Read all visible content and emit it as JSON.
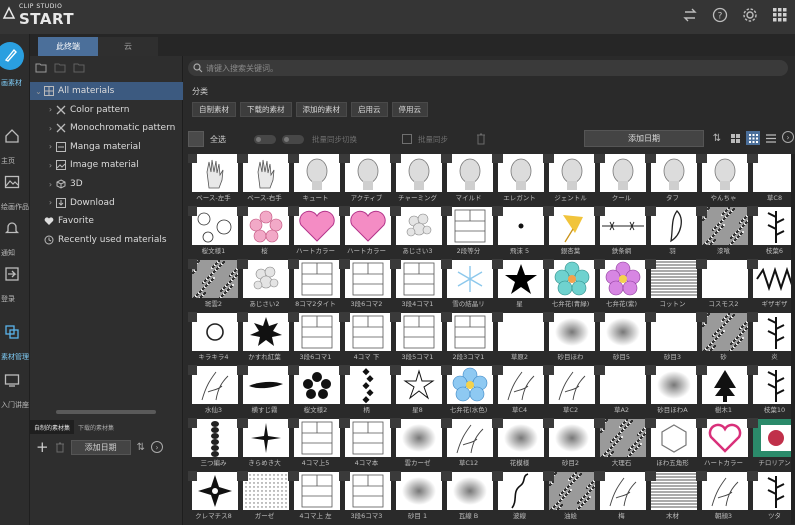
{
  "app": {
    "logo_small": "CLIP STUDIO",
    "logo_big": "START"
  },
  "colors": {
    "accent": "#2a9fe0",
    "selected": "#3c5a80",
    "tab_active": "#4b6f9a"
  },
  "titlebar_icons": [
    "sync-icon",
    "help-icon",
    "settings-icon",
    "apps-grid-icon"
  ],
  "nav": [
    {
      "label": "画素材",
      "icon": "brush-icon"
    },
    {
      "label": "主页",
      "icon": "home-icon"
    },
    {
      "label": "绘画作品",
      "icon": "artwork-icon"
    },
    {
      "label": "通知",
      "icon": "bell-icon"
    },
    {
      "label": "登录",
      "icon": "login-icon"
    },
    {
      "label": "素材管理",
      "icon": "materials-icon"
    },
    {
      "label": "入门讲座",
      "icon": "lecture-icon"
    }
  ],
  "tabs": [
    "此终端",
    "云"
  ],
  "tree": [
    {
      "label": "All materials",
      "icon": "grid-icon",
      "arrow": "⌄",
      "indent": 0,
      "selected": true
    },
    {
      "label": "Color pattern",
      "icon": "cross-icon",
      "arrow": "›",
      "indent": 1
    },
    {
      "label": "Monochromatic pattern",
      "icon": "cross-icon",
      "arrow": "›",
      "indent": 1
    },
    {
      "label": "Manga material",
      "icon": "frame-icon",
      "arrow": "›",
      "indent": 1
    },
    {
      "label": "Image material",
      "icon": "image-icon",
      "arrow": "›",
      "indent": 1
    },
    {
      "label": "3D",
      "icon": "3d-icon",
      "arrow": "›",
      "indent": 1
    },
    {
      "label": "Download",
      "icon": "download-icon",
      "arrow": "›",
      "indent": 1
    },
    {
      "label": "Favorite",
      "icon": "heart-icon",
      "arrow": "",
      "indent": 0
    },
    {
      "label": "Recently used materials",
      "icon": "history-icon",
      "arrow": "",
      "indent": 0
    }
  ],
  "tree_bottom": {
    "tab_a": "自制的素材集",
    "tab_b": "下载的素材集",
    "sort_label": "添加日期"
  },
  "search": {
    "placeholder": "请键入搜索关键词。"
  },
  "category": {
    "label": "分类",
    "tags": [
      "自制素材",
      "下载的素材",
      "添加的素材",
      "启用云",
      "停用云"
    ]
  },
  "toolbar": {
    "select_all": "全选",
    "batch_sync": "批量同步切换",
    "batch_sync2": "批量同步",
    "sort": "添加日期"
  },
  "grid": [
    [
      {
        "l": "ベース-左手",
        "k": "hand"
      },
      {
        "l": "ベース-右手",
        "k": "hand"
      },
      {
        "l": "キュート",
        "k": "head"
      },
      {
        "l": "アクティブ",
        "k": "head"
      },
      {
        "l": "チャーミング",
        "k": "head"
      },
      {
        "l": "マイルド",
        "k": "head"
      },
      {
        "l": "エレガント",
        "k": "head"
      },
      {
        "l": "ジェントル",
        "k": "head"
      },
      {
        "l": "クール",
        "k": "head"
      },
      {
        "l": "タフ",
        "k": "head"
      },
      {
        "l": "やんちゃ",
        "k": "head"
      },
      {
        "l": "草C8",
        "k": "blank"
      }
    ],
    [
      {
        "l": "桜文様1",
        "k": "pattern"
      },
      {
        "l": "桜",
        "k": "flower"
      },
      {
        "l": "ハートカラー",
        "k": "heart"
      },
      {
        "l": "ハートカラー",
        "k": "heart"
      },
      {
        "l": "あじさい3",
        "k": "hydra"
      },
      {
        "l": "2段等分",
        "k": "panels"
      },
      {
        "l": "飛沫 5",
        "k": "dot"
      },
      {
        "l": "銀杏葉",
        "k": "ginkgo"
      },
      {
        "l": "鉄条網",
        "k": "wire"
      },
      {
        "l": "羽",
        "k": "feather"
      },
      {
        "l": "漆喰",
        "k": "noise"
      },
      {
        "l": "枝葉6",
        "k": "leaf"
      }
    ],
    [
      {
        "l": "斑雲2",
        "k": "noise"
      },
      {
        "l": "あじさい2",
        "k": "hydra"
      },
      {
        "l": "8コマ2タイト",
        "k": "panels"
      },
      {
        "l": "3段6コマ2",
        "k": "panels"
      },
      {
        "l": "3段4コマ1",
        "k": "panels"
      },
      {
        "l": "雪の結晶リ",
        "k": "snow"
      },
      {
        "l": "星",
        "k": "star"
      },
      {
        "l": "七弁花(青緑)",
        "k": "cflower"
      },
      {
        "l": "七弁花(紫)",
        "k": "pflower"
      },
      {
        "l": "コットン",
        "k": "lines"
      },
      {
        "l": "コスモス2",
        "k": "blank"
      },
      {
        "l": "ギザギザ",
        "k": "zigzag"
      }
    ],
    [
      {
        "l": "キラキラ4",
        "k": "ring"
      },
      {
        "l": "かすれ紅葉",
        "k": "maple"
      },
      {
        "l": "3段6コマ1",
        "k": "panels"
      },
      {
        "l": "4コマ 下",
        "k": "panels"
      },
      {
        "l": "3段5コマ1",
        "k": "panels"
      },
      {
        "l": "2段3コマ1",
        "k": "panels"
      },
      {
        "l": "草原2",
        "k": "blank"
      },
      {
        "l": "砂目ほわ",
        "k": "blur"
      },
      {
        "l": "砂目5",
        "k": "blur"
      },
      {
        "l": "砂目3",
        "k": "blank"
      },
      {
        "l": "砂",
        "k": "noise"
      },
      {
        "l": "炎",
        "k": "leaf"
      }
    ],
    [
      {
        "l": "水仙3",
        "k": "sketch"
      },
      {
        "l": "横すじ霧",
        "k": "streak"
      },
      {
        "l": "桜文様2",
        "k": "flowerb"
      },
      {
        "l": "柄",
        "k": "diamond"
      },
      {
        "l": "星8",
        "k": "starline"
      },
      {
        "l": "七弁花(水色)",
        "k": "bflower"
      },
      {
        "l": "草C4",
        "k": "sketch"
      },
      {
        "l": "草C2",
        "k": "sketch"
      },
      {
        "l": "草A2",
        "k": "blank"
      },
      {
        "l": "砂目ほわA",
        "k": "blur"
      },
      {
        "l": "樹木1",
        "k": "tree"
      },
      {
        "l": "枝葉10",
        "k": "leaf"
      }
    ],
    [
      {
        "l": "三つ編み",
        "k": "braid"
      },
      {
        "l": "きらめき大",
        "k": "sparkle"
      },
      {
        "l": "4コマ上5",
        "k": "panels"
      },
      {
        "l": "4コマ本",
        "k": "panels"
      },
      {
        "l": "雲カーゼ",
        "k": "blur"
      },
      {
        "l": "草C12",
        "k": "sketch"
      },
      {
        "l": "花模様",
        "k": "blur"
      },
      {
        "l": "砂目2",
        "k": "blur"
      },
      {
        "l": "大理石",
        "k": "noise"
      },
      {
        "l": "ほわ五角形",
        "k": "hex"
      },
      {
        "l": "ハートカラー",
        "k": "heartline"
      },
      {
        "l": "チロリアン",
        "k": "tyrol"
      }
    ],
    [
      {
        "l": "クレマチス8",
        "k": "clem"
      },
      {
        "l": "ガーゼ",
        "k": "dots"
      },
      {
        "l": "4コマ上 左",
        "k": "panels"
      },
      {
        "l": "3段6コマ3",
        "k": "panels"
      },
      {
        "l": "砂目 1",
        "k": "blur"
      },
      {
        "l": "瓦線 B",
        "k": "blur"
      },
      {
        "l": "波線",
        "k": "wave"
      },
      {
        "l": "油絵",
        "k": "noise"
      },
      {
        "l": "梅",
        "k": "sketch"
      },
      {
        "l": "木材",
        "k": "lines"
      },
      {
        "l": "朝顔3",
        "k": "sketch"
      },
      {
        "l": "ツタ",
        "k": "leaf"
      }
    ]
  ]
}
